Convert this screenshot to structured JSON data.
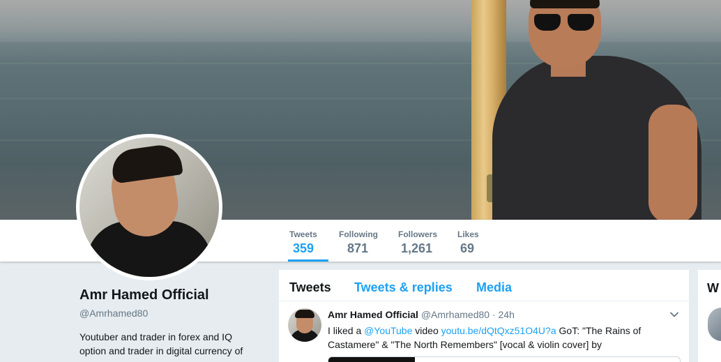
{
  "profile": {
    "name": "Amr Hamed Official",
    "handle": "@Amrhamed80",
    "bio": "Youtuber and trader in forex and IQ option and trader in digital currency of "
  },
  "stats": [
    {
      "label": "Tweets",
      "value": "359",
      "active": true
    },
    {
      "label": "Following",
      "value": "871",
      "active": false
    },
    {
      "label": "Followers",
      "value": "1,261",
      "active": false
    },
    {
      "label": "Likes",
      "value": "69",
      "active": false
    }
  ],
  "tabs": [
    {
      "label": "Tweets",
      "active": true
    },
    {
      "label": "Tweets & replies",
      "active": false
    },
    {
      "label": "Media",
      "active": false
    }
  ],
  "tweet": {
    "author_name": "Amr Hamed Official",
    "author_handle": "@Amrhamed80",
    "separator": "·",
    "time": "24h",
    "text_prefix": "I liked a ",
    "mention": "@YouTube",
    "text_mid": " video ",
    "url": "youtu.be/dQtQxz51O4U?a",
    "text_suffix": " GoT: \"The Rains of Castamere\" & \"The North Remembers\" [vocal & violin cover] by"
  },
  "right_panel": {
    "title_fragment": "W"
  },
  "colors": {
    "accent": "#1da1f2",
    "text": "#14171a",
    "muted": "#657786",
    "background": "#e6ecf0"
  },
  "icons": {
    "tweet_menu": "chevron-down-icon"
  }
}
